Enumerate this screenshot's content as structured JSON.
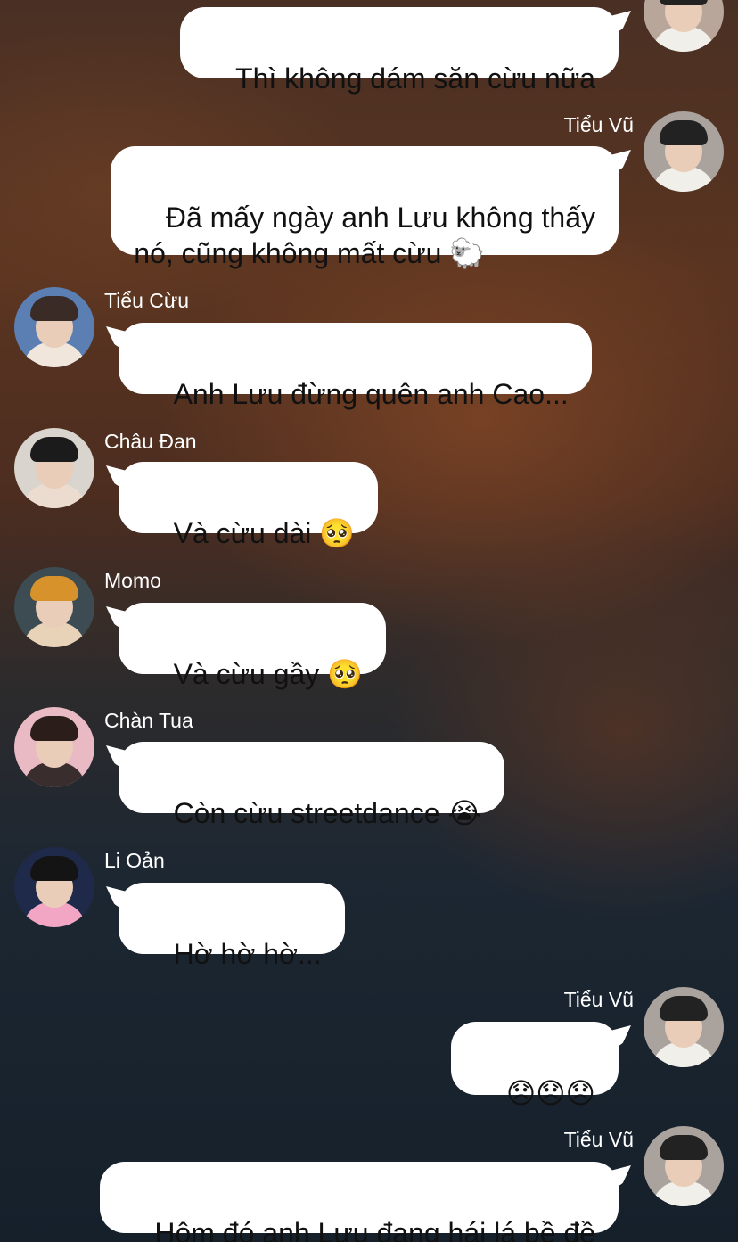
{
  "conversation": {
    "messages": [
      {
        "direction": "out",
        "sender": "",
        "text": "Thì không dám săn cừu nữa"
      },
      {
        "direction": "out",
        "sender": "Tiểu Vũ",
        "text": "Đã mấy ngày anh Lưu không thấy\nnó, cũng không mất cừu 🐑"
      },
      {
        "direction": "in",
        "sender": "Tiểu Cừu",
        "text": "Anh Lưu đừng quên anh Cao..."
      },
      {
        "direction": "in",
        "sender": "Châu Đan",
        "text": "Và cừu dài 🥺"
      },
      {
        "direction": "in",
        "sender": "Momo",
        "text": "Và cừu gầy 🥺"
      },
      {
        "direction": "in",
        "sender": "Chàn Tua",
        "text": "Còn cừu streetdance 😭"
      },
      {
        "direction": "in",
        "sender": "Li Oản",
        "text": "Hờ hờ hờ..."
      },
      {
        "direction": "out",
        "sender": "Tiểu Vũ",
        "text": "😞😞😞"
      },
      {
        "direction": "out",
        "sender": "Tiểu Vũ",
        "text": "Hôm đó anh Lưu đang hái lá bề đề"
      }
    ]
  },
  "colors": {
    "bubble": "#ffffff",
    "sender_text": "#ffffff",
    "message_text": "#111111"
  }
}
